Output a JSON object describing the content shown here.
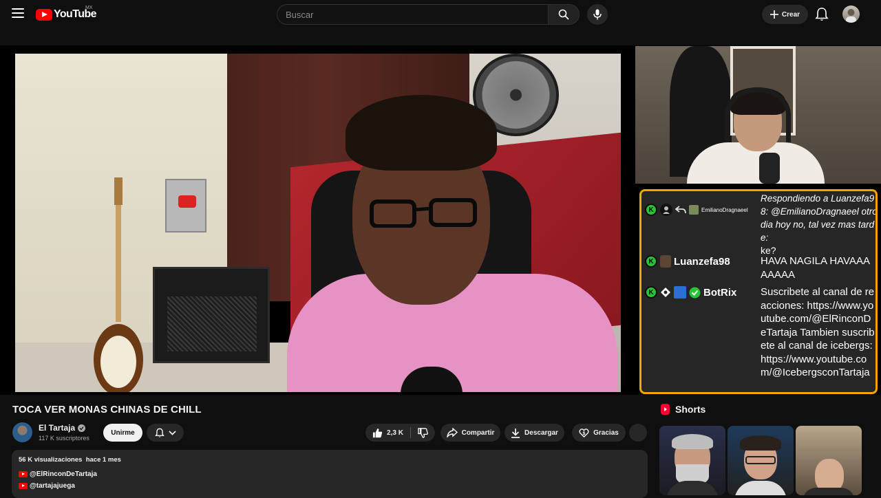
{
  "header": {
    "logo_text": "YouTube",
    "country": "MX",
    "search_placeholder": "Buscar",
    "create_label": "Crear"
  },
  "video": {
    "title": "TOCA VER MONAS CHINAS DE CHILL",
    "channel": {
      "name": "El Tartaja",
      "subscribers": "117 K suscriptores"
    },
    "join_label": "Unirme",
    "likes": "2,3 K",
    "share_label": "Compartir",
    "download_label": "Descargar",
    "thanks_label": "Gracias"
  },
  "chat": {
    "messages": [
      {
        "user": "EmilianoDragnaeel",
        "text": "Respondiendo a Luanzefa98: @EmilianoDragnaeel otro dia hoy no, tal vez mas tarde:",
        "reply": "ke?"
      },
      {
        "user": "Luanzefa98",
        "text": "HAVA NAGILA HAVAAAAAAAA"
      },
      {
        "user": "BotRix",
        "text": "Suscribete al canal de reacciones: https://www.youtube.com/@ElRinconDeTartaja Tambien suscribete al canal de icebergs: https://www.youtube.com/@IcebergsconTartaja"
      }
    ]
  },
  "description": {
    "views": "56 K visualizaciones",
    "date": "hace 1 mes",
    "links": [
      "@ElRinconDeTartaja",
      "@tartajajuega"
    ]
  },
  "shorts": {
    "heading": "Shorts"
  },
  "colors": {
    "brand_red": "#ff0000",
    "chat_border": "#f5a400",
    "kick_green": "#27c437"
  }
}
